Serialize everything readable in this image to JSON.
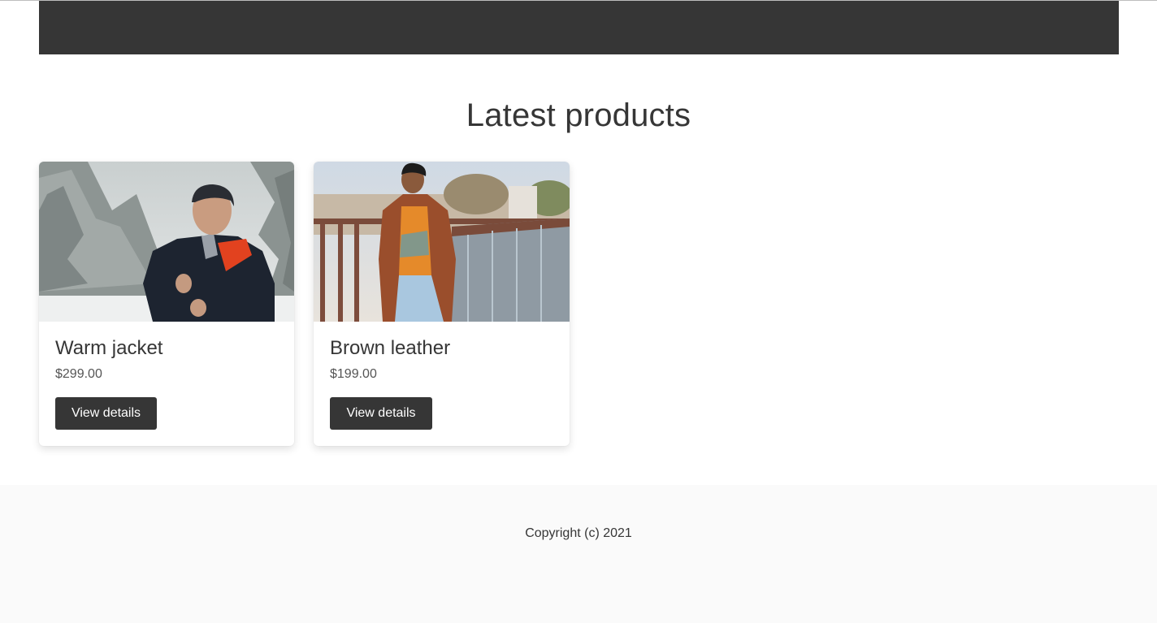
{
  "page": {
    "title": "Latest products"
  },
  "products": [
    {
      "name": "Warm jacket",
      "price": "$299.00",
      "button_label": "View details"
    },
    {
      "name": "Brown leather",
      "price": "$199.00",
      "button_label": "View details"
    }
  ],
  "footer": {
    "copyright": "Copyright (c) 2021"
  },
  "colors": {
    "navbar": "#363636",
    "button": "#363636",
    "footer_bg": "#fafafa",
    "text": "#363636"
  }
}
